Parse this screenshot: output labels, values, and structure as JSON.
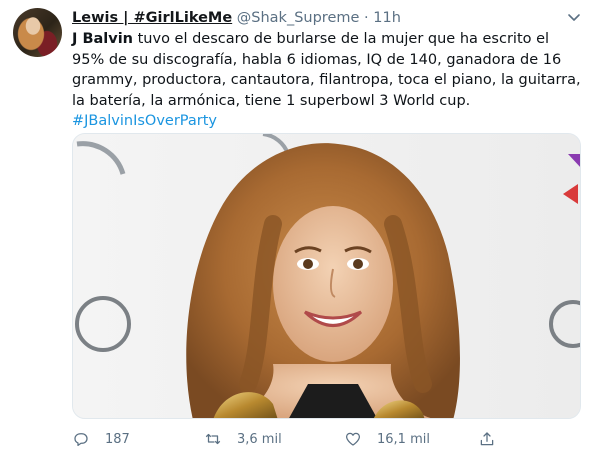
{
  "tweet": {
    "display_name": "Lewis | #GirlLikeMe",
    "handle": "@Shak_Supreme",
    "separator": "·",
    "time": "11h",
    "text_bold": "J Balvin",
    "text_rest": " tuvo el descaro de burlarse de la mujer que ha escrito el 95% de su discografía, habla 6 idiomas, IQ de 140, ganadora de 16 grammy, productora, cantautora, filantropa, toca el piano, la guitarra, la batería, la armónica, tiene 1 superbowl 3 World cup.",
    "hashtag": "#JBalvinIsOverParty"
  },
  "actions": {
    "replies": "187",
    "retweets": "3,6 mil",
    "likes": "16,1 mil"
  },
  "icons": {
    "more": "chevron-down-icon",
    "reply": "reply-icon",
    "retweet": "retweet-icon",
    "like": "heart-icon",
    "share": "share-icon"
  },
  "colors": {
    "link": "#1b95e0",
    "secondary": "#5b7083"
  }
}
